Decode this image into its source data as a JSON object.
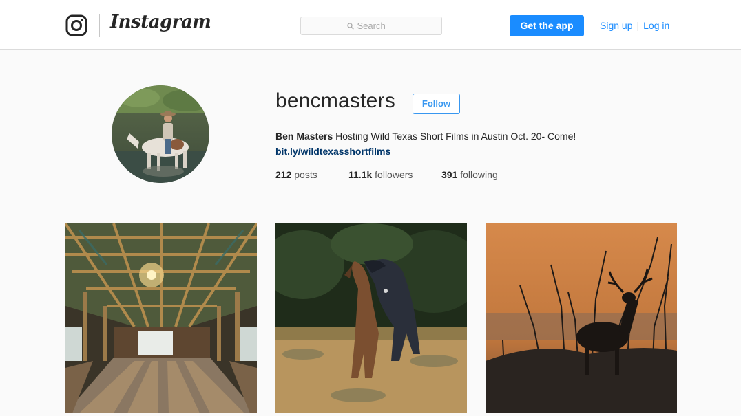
{
  "header": {
    "brand": "Instagram",
    "logo_icon": "instagram-camera-icon",
    "search_placeholder": "Search",
    "search_icon": "search-icon",
    "get_app_label": "Get the app",
    "signup_label": "Sign up",
    "login_label": "Log in",
    "accent_color": "#1a8cff"
  },
  "profile": {
    "username": "bencmasters",
    "follow_label": "Follow",
    "bio_name": "Ben Masters",
    "bio_text": " Hosting Wild Texas Short Films in Austin Oct. 20- Come!",
    "bio_link": "bit.ly/wildtexasshortfilms",
    "stats": {
      "posts_count": "212",
      "posts_label": "posts",
      "followers_count": "11.1k",
      "followers_label": "followers",
      "following_count": "391",
      "following_label": "following"
    }
  },
  "posts": [
    {
      "subject": "barn interior with long tables and chandelier"
    },
    {
      "subject": "two wild horses rearing in a field"
    },
    {
      "subject": "deer silhouette at sunset"
    }
  ]
}
